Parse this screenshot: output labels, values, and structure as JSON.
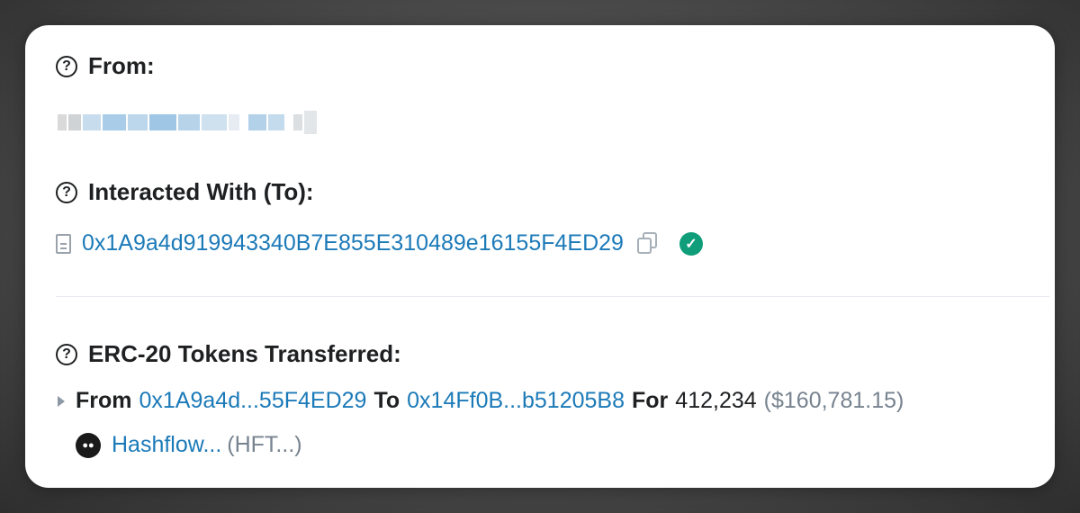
{
  "from": {
    "label": "From:",
    "value_redacted": true
  },
  "to": {
    "label": "Interacted With (To):",
    "address": "0x1A9a4d919943340B7E855E310489e16155F4ED29",
    "verified": true
  },
  "tokens": {
    "label": "ERC-20 Tokens Transferred:",
    "from_keyword": "From",
    "from_address": "0x1A9a4d...55F4ED29",
    "to_keyword": "To",
    "to_address": "0x14Ff0B...b51205B8",
    "for_keyword": "For",
    "amount": "412,234",
    "usd_value": "($160,781.15)",
    "token_name": "Hashflow...",
    "token_symbol": "(HFT...)"
  },
  "colors": {
    "link": "#1c7ab8",
    "verified_badge": "#0f9d7a",
    "text": "#1e2022",
    "muted": "#77838f"
  }
}
